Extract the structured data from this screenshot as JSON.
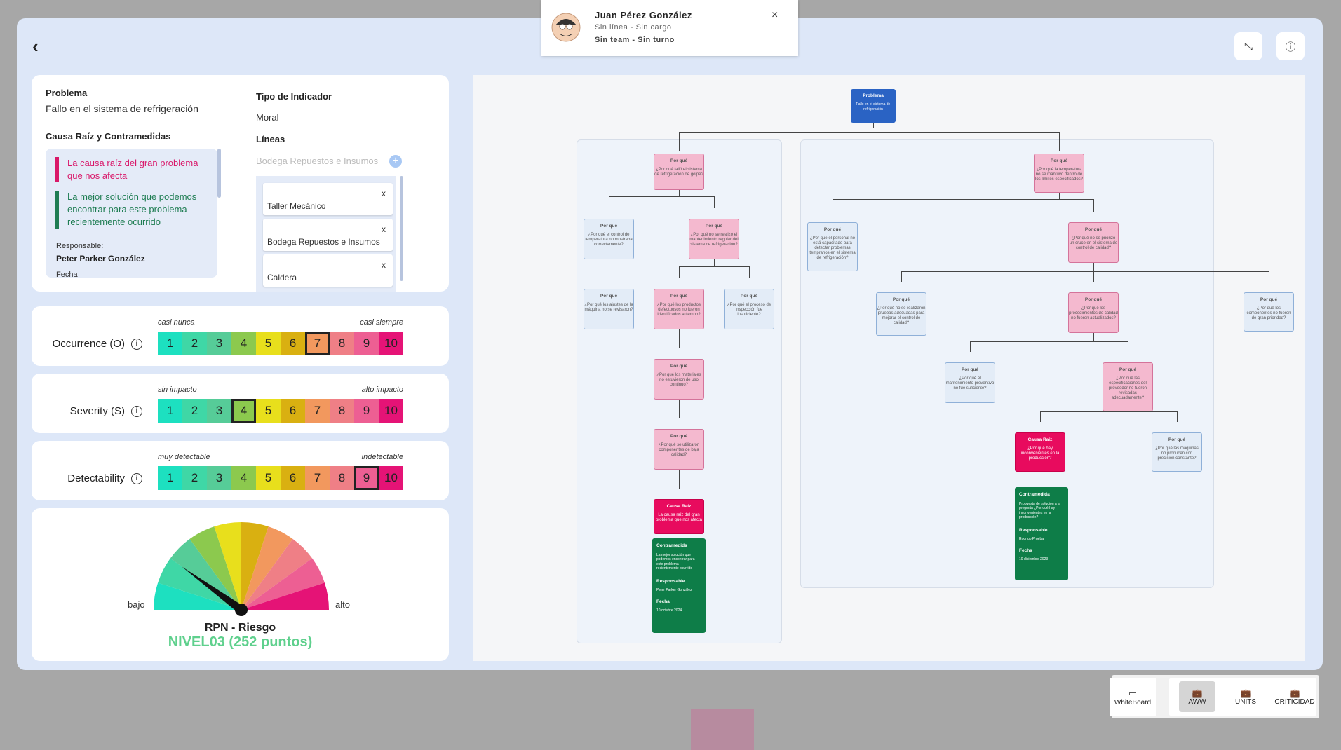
{
  "toast": {
    "name": "Juan Pérez González",
    "line1": "Sin línea - Sin cargo",
    "line2": "Sin team - Sin turno"
  },
  "info_card": {
    "problem_label": "Problema",
    "problem_value": "Fallo en el sistema de refrigeración",
    "root_label": "Causa Raíz y Contramedidas",
    "root_cause": "La causa raíz del gran problema que nos afecta",
    "countermeasure": "La mejor solución que podemos encontrar para este problema recientemente ocurrido",
    "responsible_label": "Responsable:",
    "responsible_value": "Peter Parker González",
    "cut_label": "Fecha",
    "indicator_label": "Tipo de Indicador",
    "indicator_value": "Moral",
    "lines_label": "Líneas",
    "lines_placeholder": "Bodega Repuestos e Insumos",
    "lines": [
      "Taller Mecánico",
      "Bodega Repuestos e Insumos",
      "Caldera"
    ]
  },
  "scales": [
    {
      "title": "Occurrence (O)",
      "low": "casi nunca",
      "high": "casi siempre",
      "selected": 7
    },
    {
      "title": "Severity (S)",
      "low": "sin impacto",
      "high": "alto impacto",
      "selected": 4
    },
    {
      "title": "Detectability",
      "low": "muy detectable",
      "high": "indetectable",
      "selected": 9
    }
  ],
  "scale_numbers": [
    "1",
    "2",
    "3",
    "4",
    "5",
    "6",
    "7",
    "8",
    "9",
    "10"
  ],
  "scale_colors": [
    "#1de0c0",
    "#3fd7a6",
    "#56cc98",
    "#8cc94e",
    "#e8df1c",
    "#d9b011",
    "#f2985e",
    "#ef7f86",
    "#ed5f93",
    "#e51376"
  ],
  "gauge": {
    "low_label": "bajo",
    "high_label": "alto",
    "title": "RPN - Riesgo",
    "level": "NIVEL03 (252 puntos)",
    "needle_fraction": 0.2,
    "level_color": "#5fd08d"
  },
  "diagram": {
    "problem_title": "Problema",
    "problem_text": "Fallo en el sistema de refrigeración",
    "why": "Por qué",
    "root": "Causa Raíz",
    "left_root_text": "La causa raíz del gran problema que nos afecta",
    "right_root_text": "¿Por qué hay inconvenientes en la producción?",
    "counter_label": "Contramedida",
    "resp_label": "Responsable",
    "date_label": "Fecha",
    "left_counter_text": "La mejor solución que podemos encontrar para este problema recientemente ocurrido",
    "left_resp": "Peter Parker González",
    "left_date": "10 octubre 2024",
    "right_counter_text": "Propuesta de solución a la pregunta ¿Por qué hay inconvenientes en la producción?",
    "right_resp": "Rodrigo Prueba",
    "right_date": "10 diciembre 2023",
    "q_left_1": "¿Por qué falló el sistema de refrigeración de golpe?",
    "q_left_2a": "¿Por qué el control de temperatura no mostraba correctamente?",
    "q_left_2b": "¿Por qué no se realizó el mantenimiento regular del sistema de refrigeración?",
    "q_left_3a": "¿Por qué los ajustes de la máquina no se revisaron?",
    "q_left_3b": "¿Por qué los productos defectuosos no fueron identificados a tiempo?",
    "q_left_3c": "¿Por qué el proceso de inspección fue insuficiente?",
    "q_left_4": "¿Por qué los materiales no estuvieron de uso continuo?",
    "q_left_5": "¿Por qué se utilizaron componentes de baja calidad?",
    "q_right_1": "¿Por qué la temperatura no se mantuvo dentro de los límites especificados?",
    "q_right_2a": "¿Por qué el personal no está capacitado para detectar problemas tempranos en el sistema de refrigeración?",
    "q_right_2b": "¿Por qué no se priorizó un cruce en el sistema de control de calidad?",
    "q_right_3a": "¿Por qué no se realizaron pruebas adecuadas para mejorar el control de calidad?",
    "q_right_3b": "¿Por qué los procedimientos de calidad no fueron actualizados?",
    "q_right_3c": "¿Por qué los componentes no fueron de gran prioridad?",
    "q_right_4a": "¿Por qué el mantenimiento preventivo no fue suficiente?",
    "q_right_4b": "¿Por qué las especificaciones del proveedor no fueron revisadas adecuadamente?",
    "q_right_5": "¿Por qué las máquinas no producen con precisión constante?"
  },
  "toolbar": {
    "whiteboard": "WhiteBoard",
    "aww": "AWW",
    "units": "UNITS",
    "criticidad": "CRITICIDAD"
  }
}
